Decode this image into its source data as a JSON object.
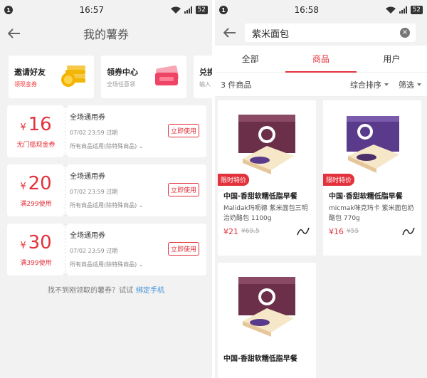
{
  "left": {
    "status": {
      "notif": "1",
      "time": "16:57",
      "battery": "52"
    },
    "header": {
      "title": "我的薯券"
    },
    "promos": [
      {
        "title": "邀请好友",
        "sub": "领现金券",
        "icon": "gold-coins-icon"
      },
      {
        "title": "领券中心",
        "sub": "全场任意领",
        "icon": "ticket-icon"
      },
      {
        "title": "兑换",
        "sub": "输入",
        "icon": "exchange-icon"
      }
    ],
    "coupons": [
      {
        "yen": "¥",
        "amount": "16",
        "condition": "无门槛现金券",
        "title": "全场通用券",
        "date": "07/02 23:59 过期",
        "note": "所有商品适用(除特殊商品)",
        "button": "立即使用"
      },
      {
        "yen": "¥",
        "amount": "20",
        "condition": "满299使用",
        "title": "全场通用券",
        "date": "07/02 23:59 过期",
        "note": "所有商品适用(除特殊商品)",
        "button": "立即使用"
      },
      {
        "yen": "¥",
        "amount": "30",
        "condition": "满399使用",
        "title": "全场通用券",
        "date": "07/02 23:59 过期",
        "note": "所有商品适用(除特殊商品)",
        "button": "立即使用"
      }
    ],
    "hint": {
      "text": "找不到刚领取的薯券？试试",
      "link": "绑定手机"
    }
  },
  "right": {
    "status": {
      "notif": "1",
      "time": "16:58",
      "battery": "52"
    },
    "search": {
      "value": "紫米面包"
    },
    "tabs": [
      {
        "label": "全部"
      },
      {
        "label": "商品"
      },
      {
        "label": "用户"
      }
    ],
    "filter": {
      "count": "3 件商品",
      "sort": "综合排序",
      "filter": "筛选"
    },
    "products": [
      {
        "tag": "限时特价",
        "name": "中国·香甜软糯低脂早餐",
        "desc": "Malidak玛呖德 紫米面包三明治奶酪包 1100g",
        "price": "¥21",
        "old_price": "¥69.5",
        "box_color": "#6b2f4a"
      },
      {
        "tag": "限时特价",
        "name": "中国·香甜软糯低脂早餐",
        "desc": "micmak咪克玛卡 紫米面包奶酪包 770g",
        "price": "¥16",
        "old_price": "¥55",
        "box_color": "#5a3a8a"
      },
      {
        "tag": "",
        "name": "中国·香甜软糯低脂早餐",
        "desc": "",
        "price": "",
        "old_price": "",
        "box_color": "#6b2f4a"
      }
    ]
  },
  "colors": {
    "accent": "#e3323c",
    "link": "#3b8fd8",
    "bg": "#f2f2f2"
  }
}
